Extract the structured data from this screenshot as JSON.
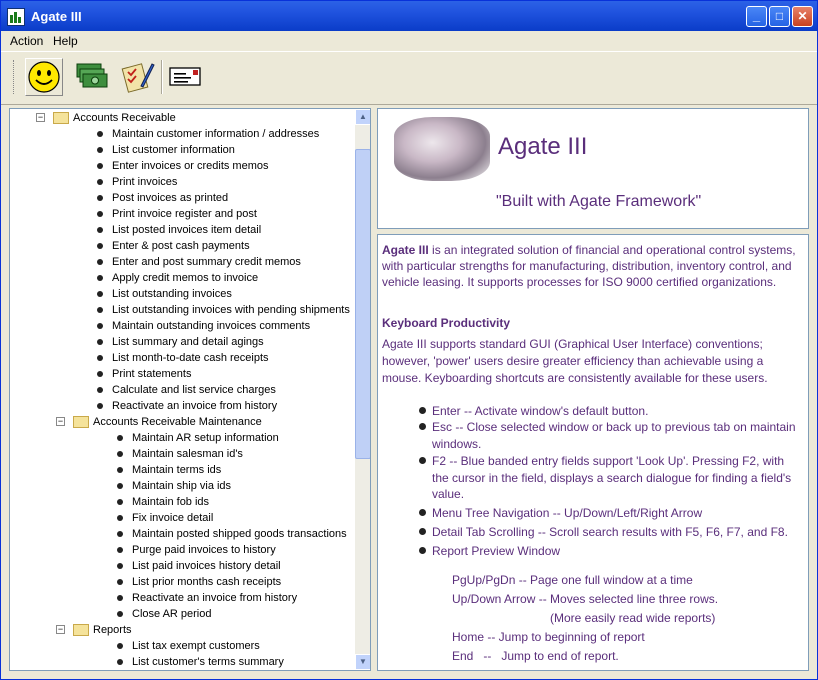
{
  "window": {
    "title": "Agate III",
    "min_label": "_",
    "max_label": "□",
    "close_label": "✕"
  },
  "menu": {
    "items": [
      "Action",
      "Help"
    ]
  },
  "toolbar": {
    "icons": [
      "smiley-icon",
      "money-icon",
      "checklist-icon",
      "envelope-icon"
    ]
  },
  "tree": {
    "items": [
      {
        "label": "Accounts Receivable",
        "level": 0,
        "kind": "folder",
        "expander": "−"
      },
      {
        "label": "Maintain customer information / addresses",
        "level": 1,
        "kind": "leaf"
      },
      {
        "label": "List customer information",
        "level": 1,
        "kind": "leaf"
      },
      {
        "label": "Enter invoices or credits memos",
        "level": 1,
        "kind": "leaf"
      },
      {
        "label": "Print invoices",
        "level": 1,
        "kind": "leaf"
      },
      {
        "label": "Post invoices as printed",
        "level": 1,
        "kind": "leaf"
      },
      {
        "label": "Print invoice register and post",
        "level": 1,
        "kind": "leaf"
      },
      {
        "label": "List posted invoices item detail",
        "level": 1,
        "kind": "leaf"
      },
      {
        "label": "Enter & post cash payments",
        "level": 1,
        "kind": "leaf"
      },
      {
        "label": "Enter and post summary credit memos",
        "level": 1,
        "kind": "leaf"
      },
      {
        "label": "Apply credit memos to invoice",
        "level": 1,
        "kind": "leaf"
      },
      {
        "label": "List outstanding invoices",
        "level": 1,
        "kind": "leaf"
      },
      {
        "label": "List outstanding invoices with pending shipments",
        "level": 1,
        "kind": "leaf"
      },
      {
        "label": "Maintain outstanding invoices comments",
        "level": 1,
        "kind": "leaf"
      },
      {
        "label": "List summary and detail agings",
        "level": 1,
        "kind": "leaf"
      },
      {
        "label": "List month-to-date cash receipts",
        "level": 1,
        "kind": "leaf"
      },
      {
        "label": "Print statements",
        "level": 1,
        "kind": "leaf"
      },
      {
        "label": "Calculate and list service charges",
        "level": 1,
        "kind": "leaf"
      },
      {
        "label": "Reactivate an invoice from history",
        "level": 1,
        "kind": "leaf"
      },
      {
        "label": "Accounts Receivable Maintenance",
        "level": 1,
        "kind": "folder",
        "expander": "−"
      },
      {
        "label": "Maintain AR setup information",
        "level": 2,
        "kind": "leaf"
      },
      {
        "label": "Maintain salesman id's",
        "level": 2,
        "kind": "leaf"
      },
      {
        "label": "Maintain terms ids",
        "level": 2,
        "kind": "leaf"
      },
      {
        "label": "Maintain ship via ids",
        "level": 2,
        "kind": "leaf"
      },
      {
        "label": "Maintain fob ids",
        "level": 2,
        "kind": "leaf"
      },
      {
        "label": "Fix invoice detail",
        "level": 2,
        "kind": "leaf"
      },
      {
        "label": "Maintain posted shipped goods transactions",
        "level": 2,
        "kind": "leaf"
      },
      {
        "label": "Purge paid invoices to history",
        "level": 2,
        "kind": "leaf"
      },
      {
        "label": "List paid invoices history detail",
        "level": 2,
        "kind": "leaf"
      },
      {
        "label": "List prior months cash receipts",
        "level": 2,
        "kind": "leaf"
      },
      {
        "label": "Reactivate an invoice from history",
        "level": 2,
        "kind": "leaf"
      },
      {
        "label": "Close AR period",
        "level": 2,
        "kind": "leaf"
      },
      {
        "label": "Reports",
        "level": 1,
        "kind": "folder",
        "expander": "−"
      },
      {
        "label": "List tax exempt customers",
        "level": 2,
        "kind": "leaf"
      },
      {
        "label": "List customer's terms summary",
        "level": 2,
        "kind": "leaf"
      }
    ],
    "scroll_up": "▲",
    "scroll_down": "▼"
  },
  "header": {
    "app_name": "Agate III",
    "tagline": "\"Built with Agate Framework\""
  },
  "content": {
    "intro_bold": "Agate III",
    "intro_text": " is an integrated solution of financial and operational control systems, with particular strengths for manufacturing, distribution, inventory control, and vehicle leasing.  It supports processes for ISO 9000 certified organizations.",
    "heading": "Keyboard Productivity",
    "para2": "Agate III supports standard GUI (Graphical User Interface) conventions; however, 'power' users desire greater efficiency than achievable using a mouse.  Keyboarding shortcuts are consistently available for these users.",
    "bullets": [
      "Enter -- Activate window's default button.",
      "Esc -- Close selected window or back up to previous tab on maintain windows.",
      "F2 -- Blue banded entry fields support 'Look Up'.  Pressing F2, with the cursor in the field, displays a search dialogue for finding a field's value.",
      "Menu Tree Navigation -- Up/Down/Left/Right Arrow",
      "Detail Tab Scrolling -- Scroll search results with F5, F6, F7, and F8.",
      "Report Preview Window"
    ],
    "preview_keys": [
      "PgUp/PgDn -- Page one full window at a time",
      "Up/Down Arrow -- Moves selected line three rows.",
      "(More easily read wide reports)",
      "Home -- Jump to beginning of report",
      "End   --   Jump to end of report."
    ]
  }
}
